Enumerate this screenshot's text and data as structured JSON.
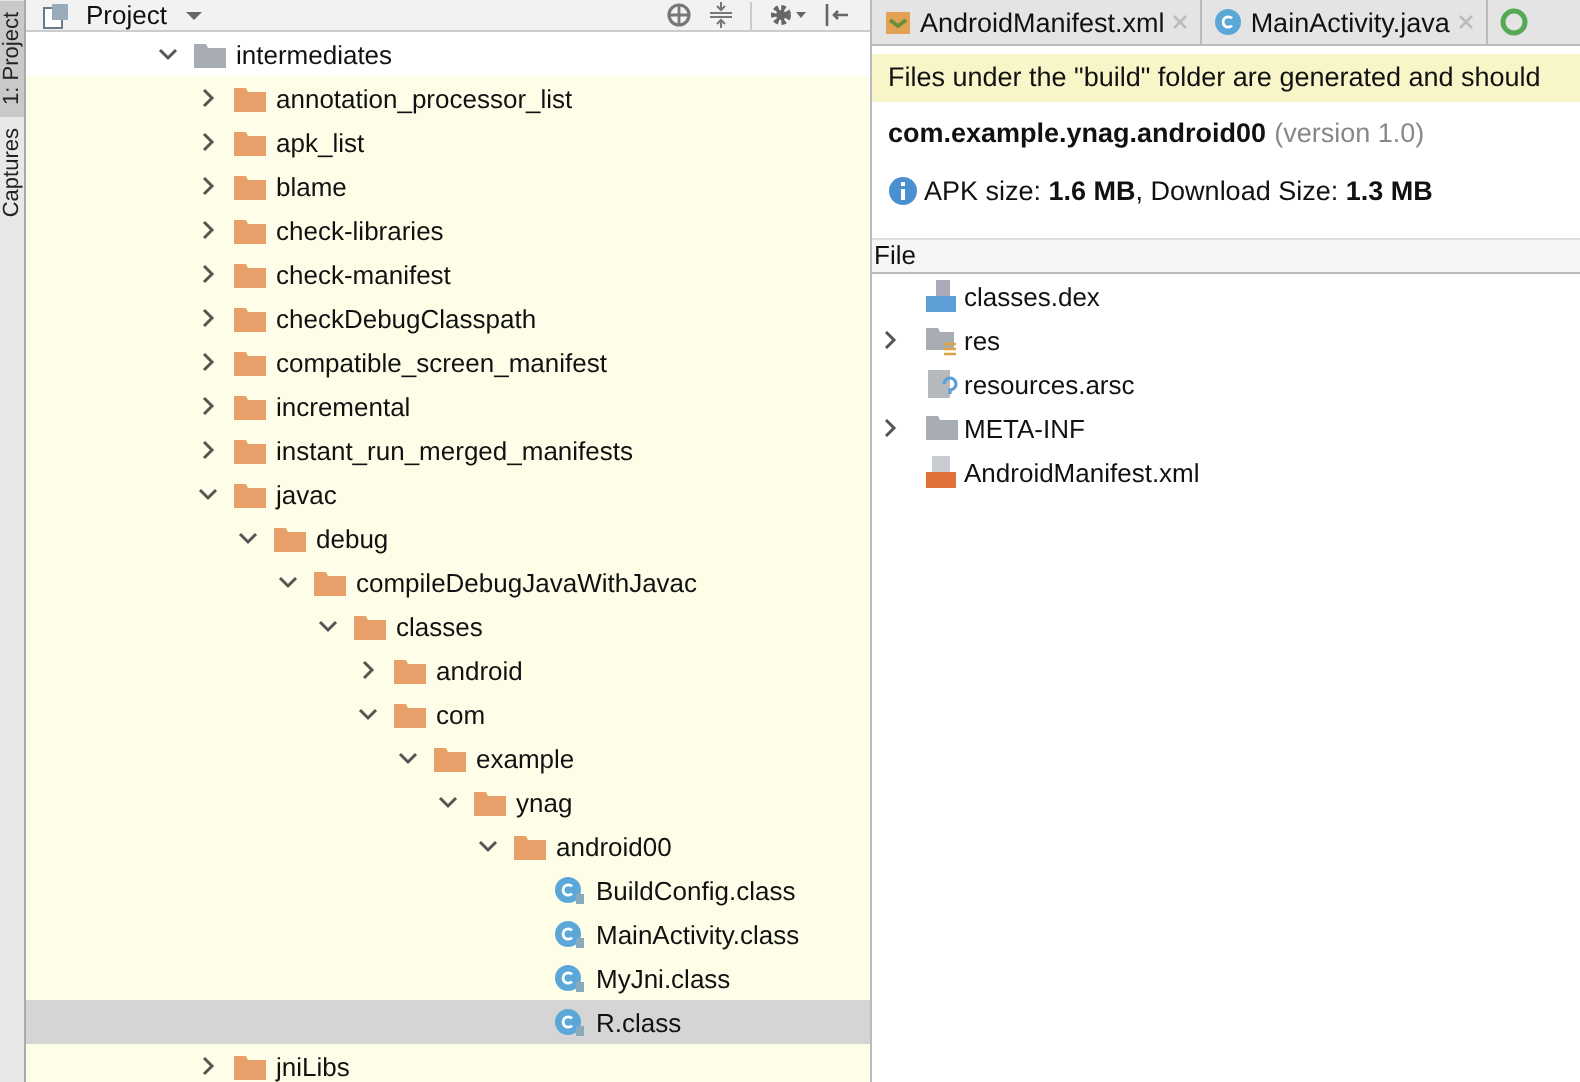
{
  "side_strip": {
    "tabs": [
      {
        "label": "1: Project",
        "selected": true
      },
      {
        "label": "Captures",
        "selected": false
      }
    ]
  },
  "project_panel": {
    "title": "Project",
    "tree": [
      {
        "name": "intermediates",
        "kind": "build-folder",
        "expanded": true,
        "selected": false,
        "children": [
          {
            "name": "annotation_processor_list",
            "kind": "folder",
            "expanded": false,
            "selected": false
          },
          {
            "name": "apk_list",
            "kind": "folder",
            "expanded": false,
            "selected": false
          },
          {
            "name": "blame",
            "kind": "folder",
            "expanded": false,
            "selected": false
          },
          {
            "name": "check-libraries",
            "kind": "folder",
            "expanded": false,
            "selected": false
          },
          {
            "name": "check-manifest",
            "kind": "folder",
            "expanded": false,
            "selected": false
          },
          {
            "name": "checkDebugClasspath",
            "kind": "folder",
            "expanded": false,
            "selected": false
          },
          {
            "name": "compatible_screen_manifest",
            "kind": "folder",
            "expanded": false,
            "selected": false
          },
          {
            "name": "incremental",
            "kind": "folder",
            "expanded": false,
            "selected": false
          },
          {
            "name": "instant_run_merged_manifests",
            "kind": "folder",
            "expanded": false,
            "selected": false
          },
          {
            "name": "javac",
            "kind": "folder",
            "expanded": true,
            "selected": false,
            "children": [
              {
                "name": "debug",
                "kind": "folder",
                "expanded": true,
                "selected": false,
                "children": [
                  {
                    "name": "compileDebugJavaWithJavac",
                    "kind": "folder",
                    "expanded": true,
                    "selected": false,
                    "children": [
                      {
                        "name": "classes",
                        "kind": "folder",
                        "expanded": true,
                        "selected": false,
                        "children": [
                          {
                            "name": "android",
                            "kind": "folder",
                            "expanded": false,
                            "selected": false
                          },
                          {
                            "name": "com",
                            "kind": "folder",
                            "expanded": true,
                            "selected": false,
                            "children": [
                              {
                                "name": "example",
                                "kind": "folder",
                                "expanded": true,
                                "selected": false,
                                "children": [
                                  {
                                    "name": "ynag",
                                    "kind": "folder",
                                    "expanded": true,
                                    "selected": false,
                                    "children": [
                                      {
                                        "name": "android00",
                                        "kind": "folder",
                                        "expanded": true,
                                        "selected": false,
                                        "children": [
                                          {
                                            "name": "BuildConfig.class",
                                            "kind": "class",
                                            "selected": false
                                          },
                                          {
                                            "name": "MainActivity.class",
                                            "kind": "class",
                                            "selected": false
                                          },
                                          {
                                            "name": "MyJni.class",
                                            "kind": "class",
                                            "selected": false
                                          },
                                          {
                                            "name": "R.class",
                                            "kind": "class",
                                            "selected": true
                                          }
                                        ]
                                      }
                                    ]
                                  }
                                ]
                              }
                            ]
                          }
                        ]
                      }
                    ]
                  }
                ]
              }
            ]
          },
          {
            "name": "jniLibs",
            "kind": "folder",
            "expanded": false,
            "selected": false
          }
        ]
      }
    ]
  },
  "editor": {
    "tabs": [
      {
        "label": "AndroidManifest.xml",
        "kind": "manifest"
      },
      {
        "label": "MainActivity.java",
        "kind": "class"
      }
    ],
    "notice": "Files under the \"build\" folder are generated and should",
    "package": "com.example.ynag.android00",
    "version": "(version 1.0)",
    "apk_info": "APK size: **1.6 MB**, Download Size: **1.3 MB**",
    "column": "File",
    "files": [
      {
        "name": "classes.dex",
        "kind": "dex"
      },
      {
        "name": "res",
        "kind": "res",
        "expanded": false
      },
      {
        "name": "resources.arsc",
        "kind": "arsc"
      },
      {
        "name": "META-INF",
        "kind": "folder",
        "expanded": false
      },
      {
        "name": "AndroidManifest.xml",
        "kind": "manifest"
      }
    ]
  }
}
